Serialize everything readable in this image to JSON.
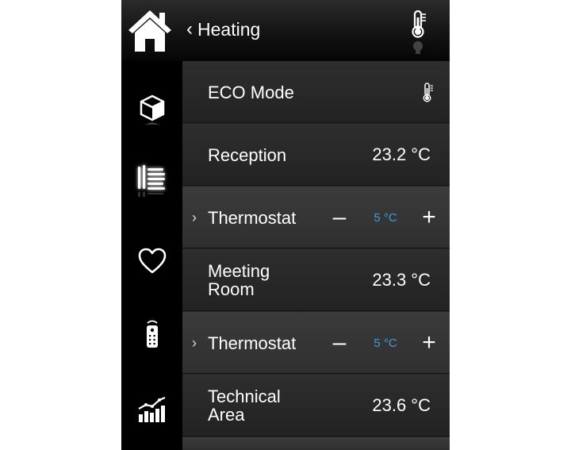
{
  "header": {
    "back_label": "Heating",
    "icons": [
      "home-icon",
      "chevron-left-icon",
      "thermometer-icon"
    ]
  },
  "sidebar": {
    "items": [
      {
        "icon": "cube-icon"
      },
      {
        "icon": "radiator-icon",
        "active": true
      },
      {
        "icon": "heart-icon"
      },
      {
        "icon": "remote-icon"
      },
      {
        "icon": "chart-icon"
      }
    ]
  },
  "list": {
    "rows": [
      {
        "label": "ECO Mode",
        "icon": "thermometer-icon"
      },
      {
        "label": "Reception",
        "value": "23.2 °C"
      },
      {
        "label": "Thermostat",
        "expand": "›",
        "minus": "–",
        "setpoint": "5 °C",
        "plus": "+"
      },
      {
        "label_lines": [
          "Meeting",
          "Room"
        ],
        "value": "23.3 °C"
      },
      {
        "label": "Thermostat",
        "expand": "›",
        "minus": "–",
        "setpoint": "5 °C",
        "plus": "+"
      },
      {
        "label_lines": [
          "Technical",
          "Area"
        ],
        "value": "23.6 °C"
      }
    ]
  },
  "colors": {
    "accent_blue": "#3d9fd9",
    "background": "#000000",
    "text": "#ffffff"
  }
}
